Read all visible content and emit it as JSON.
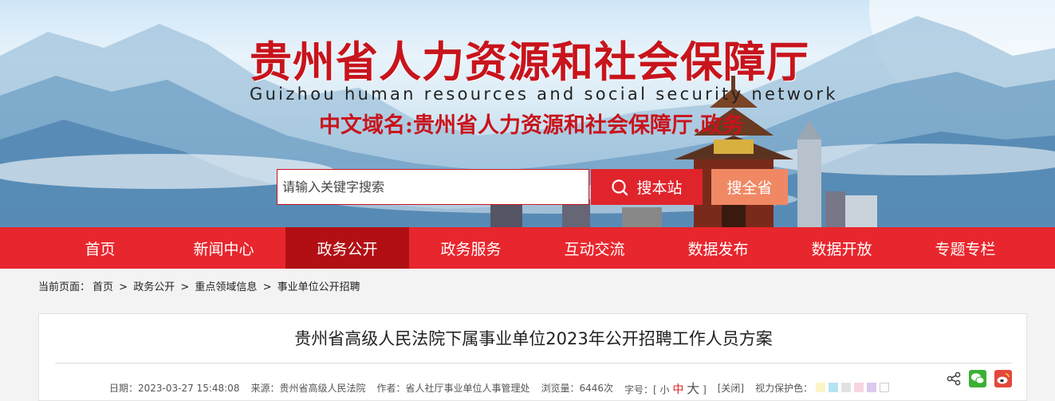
{
  "header": {
    "title": "贵州省人力资源和社会保障厅",
    "title_en": "Guizhou human resources and social security network",
    "domain_name": "中文域名:贵州省人力资源和社会保障厅.政务"
  },
  "search": {
    "placeholder": "请输入关键字搜索",
    "site_button": "搜本站",
    "all_button": "搜全省"
  },
  "nav": {
    "items": [
      "首页",
      "新闻中心",
      "政务公开",
      "政务服务",
      "互动交流",
      "数据发布",
      "数据开放",
      "专题专栏"
    ],
    "active": "政务公开"
  },
  "breadcrumb": {
    "label": "当前页面：",
    "items": [
      "首页",
      "政务公开",
      "重点领域信息",
      "事业单位公开招聘"
    ],
    "separator": ">"
  },
  "article": {
    "title": "贵州省高级人民法院下属事业单位2023年公开招聘工作人员方案",
    "date": "日期：2023-03-27 15:48:08",
    "source": "来源：贵州省高级人民法院",
    "author": "作者：省人社厅事业单位人事管理处",
    "views": "浏览量：6446次",
    "font_size_label": "字号：[",
    "font_small": "小",
    "font_medium": "中",
    "font_large": "大",
    "font_size_close": "]",
    "close": "[关闭]",
    "vision_label": "视力保护色：",
    "vision_colors": [
      "#fbf5c5",
      "#b7e3f4",
      "#e2e2e2",
      "#f7d5e0",
      "#dcc8f0",
      "#ffffff"
    ]
  },
  "share": {
    "icons": [
      "share-icon",
      "wechat-icon",
      "weibo-icon"
    ]
  }
}
